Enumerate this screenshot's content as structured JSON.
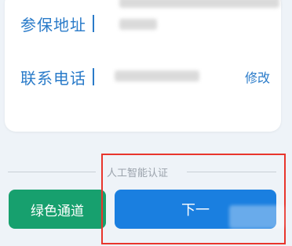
{
  "card": {
    "address_label": "参保地址",
    "phone_label": "联系电话",
    "modify_label": "修改"
  },
  "divider": {
    "text": "人工智能认证"
  },
  "actions": {
    "green_channel_label": "绿色通道",
    "next_label": "下一"
  },
  "colors": {
    "label_blue": "#2a7bc9",
    "green_button": "#17a06e",
    "next_button": "#1a7fe0",
    "highlight_red": "#e8352c",
    "background": "#eef3f8"
  }
}
